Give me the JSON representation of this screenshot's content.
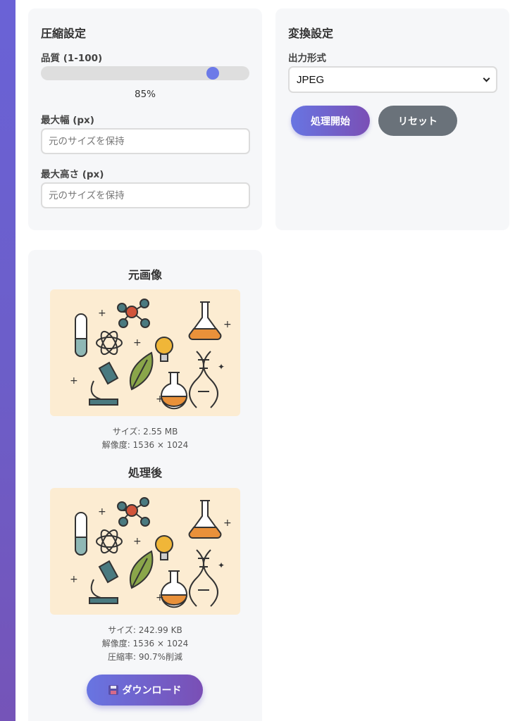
{
  "compress": {
    "title": "圧縮設定",
    "quality_label": "品質 (1-100)",
    "quality_value": 85,
    "quality_display": "85%",
    "max_width_label": "最大幅 (px)",
    "max_width_placeholder": "元のサイズを保持",
    "max_height_label": "最大高さ (px)",
    "max_height_placeholder": "元のサイズを保持"
  },
  "convert": {
    "title": "変換設定",
    "format_label": "出力形式",
    "format_value": "JPEG",
    "start_label": "処理開始",
    "reset_label": "リセット"
  },
  "original": {
    "title": "元画像",
    "size": "サイズ: 2.55 MB",
    "resolution": "解像度: 1536 × 1024"
  },
  "processed": {
    "title": "処理後",
    "size": "サイズ: 242.99 KB",
    "resolution": "解像度: 1536 × 1024",
    "ratio": "圧縮率: 90.7%削減",
    "download_label": "ダウンロード"
  },
  "colors": {
    "accent": "#6c7ae8",
    "accent_end": "#7a4fb5",
    "secondary": "#6a727a",
    "panel_bg": "#f6f7f9",
    "image_bg": "#fcecd2"
  }
}
